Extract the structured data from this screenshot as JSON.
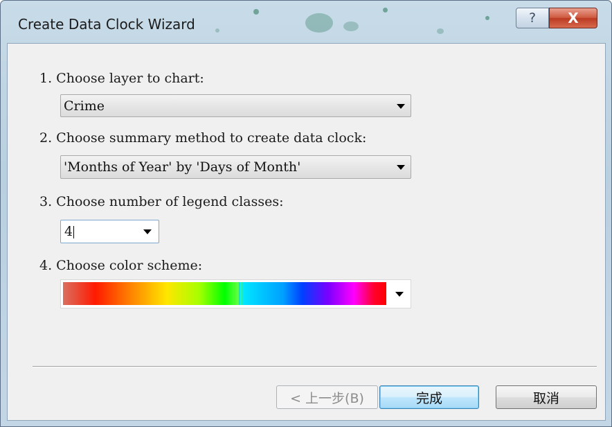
{
  "window": {
    "title": "Create Data Clock Wizard",
    "help_glyph": "?",
    "close_glyph": "X"
  },
  "steps": {
    "layer": {
      "label": "1. Choose layer to chart:",
      "selected": "Crime"
    },
    "summary": {
      "label": "2. Choose summary method to create data clock:",
      "selected": "'Months of Year' by 'Days of Month'"
    },
    "classes": {
      "label": "3. Choose number of legend classes:",
      "value": "4"
    },
    "color": {
      "label": "4. Choose color scheme:",
      "selected": "color-ramp-rainbow"
    }
  },
  "buttons": {
    "back": "< 上一步(B)",
    "finish": "完成",
    "cancel": "取消"
  },
  "colors": {
    "accent": "#3c7fb1",
    "close": "#c74a32"
  }
}
